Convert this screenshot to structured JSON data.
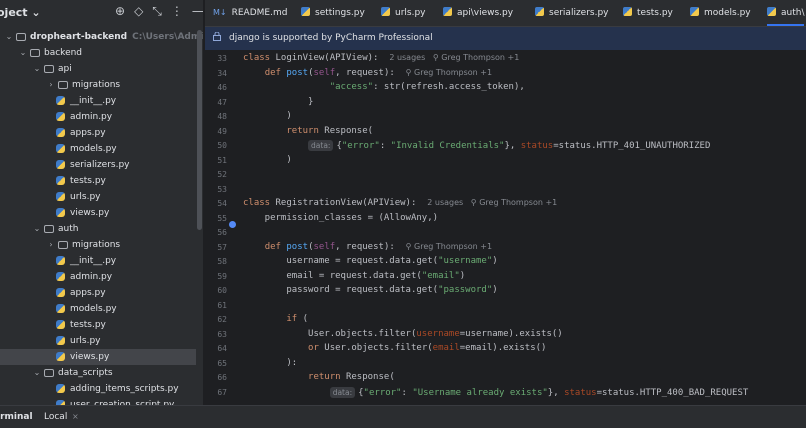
{
  "sidebar": {
    "title": "oject",
    "rows": [
      {
        "chev": "⌄",
        "icon": "folder",
        "label": "dropheart-backend",
        "bold": true,
        "path": "C:\\Users\\Admin\\Documents",
        "indent": 0
      },
      {
        "chev": "⌄",
        "icon": "folder",
        "label": "backend",
        "indent": 1
      },
      {
        "chev": "⌄",
        "icon": "folder",
        "label": "api",
        "indent": 2
      },
      {
        "chev": "›",
        "icon": "folder",
        "label": "migrations",
        "indent": 3
      },
      {
        "icon": "py",
        "label": "__init__.py",
        "indent": 4
      },
      {
        "icon": "py",
        "label": "admin.py",
        "indent": 4
      },
      {
        "icon": "py",
        "label": "apps.py",
        "indent": 4
      },
      {
        "icon": "py",
        "label": "models.py",
        "indent": 4
      },
      {
        "icon": "py",
        "label": "serializers.py",
        "indent": 4
      },
      {
        "icon": "py",
        "label": "tests.py",
        "indent": 4
      },
      {
        "icon": "py",
        "label": "urls.py",
        "indent": 4
      },
      {
        "icon": "py",
        "label": "views.py",
        "indent": 4
      },
      {
        "chev": "⌄",
        "icon": "folder",
        "label": "auth",
        "indent": 2
      },
      {
        "chev": "›",
        "icon": "folder",
        "label": "migrations",
        "indent": 3
      },
      {
        "icon": "py",
        "label": "__init__.py",
        "indent": 4
      },
      {
        "icon": "py",
        "label": "admin.py",
        "indent": 4
      },
      {
        "icon": "py",
        "label": "apps.py",
        "indent": 4
      },
      {
        "icon": "py",
        "label": "models.py",
        "indent": 4
      },
      {
        "icon": "py",
        "label": "tests.py",
        "indent": 4
      },
      {
        "icon": "py",
        "label": "urls.py",
        "indent": 4
      },
      {
        "icon": "py",
        "label": "views.py",
        "indent": 4,
        "selected": true
      },
      {
        "chev": "⌄",
        "icon": "folder",
        "label": "data_scripts",
        "indent": 2
      },
      {
        "icon": "py",
        "label": "adding_items_scripts.py",
        "indent": 4
      },
      {
        "icon": "py",
        "label": "user_creation_script.py",
        "indent": 4
      }
    ]
  },
  "tabs": [
    {
      "label": "README.md",
      "icon": "md",
      "prefix": "M↓"
    },
    {
      "label": "settings.py",
      "icon": "py"
    },
    {
      "label": "urls.py",
      "icon": "py"
    },
    {
      "label": "api\\views.py",
      "icon": "py"
    },
    {
      "label": "serializers.py",
      "icon": "py"
    },
    {
      "label": "tests.py",
      "icon": "py"
    },
    {
      "label": "models.py",
      "icon": "py"
    },
    {
      "label": "auth\\",
      "icon": "py",
      "active": true
    }
  ],
  "banner": {
    "text": "django is supported by PyCharm Professional"
  },
  "code": {
    "lines": [
      {
        "n": "33",
        "html": "<span class='kw'>class</span> LoginView(APIView):  <span class='hint'>2 usages   ⚲ Greg Thompson +1</span>"
      },
      {
        "n": "34",
        "html": "    <span class='kw'>def</span> <span class='fn'>post</span>(<span class='self'>self</span>, request):  <span class='hint'>⚲ Greg Thompson +1</span>"
      },
      {
        "n": "46",
        "html": "                <span class='str'>\"access\"</span>: str(refresh.access_token),"
      },
      {
        "n": "47",
        "html": "            }"
      },
      {
        "n": "48",
        "html": "        )"
      },
      {
        "n": "49",
        "html": "        <span class='kw'>return</span> Response("
      },
      {
        "n": "50",
        "html": "            <span class='badge'>data:</span>{<span class='str'>\"error\"</span>: <span class='str'>\"Invalid Credentials\"</span>}, <span class='kwarg'>status</span>=status.HTTP_401_UNAUTHORIZED"
      },
      {
        "n": "51",
        "html": "        )"
      },
      {
        "n": "52",
        "html": ""
      },
      {
        "n": "53",
        "html": ""
      },
      {
        "n": "54",
        "html": "<span class='kw'>class</span> RegistrationView(APIView):  <span class='hint'>2 usages   ⚲ Greg Thompson +1</span>"
      },
      {
        "n": "55",
        "html": "    permission_classes = (AllowAny,)"
      },
      {
        "n": "56",
        "html": ""
      },
      {
        "n": "57",
        "html": "    <span class='kw'>def</span> <span class='fn'>post</span>(<span class='self'>self</span>, request):  <span class='hint'>⚲ Greg Thompson +1</span>"
      },
      {
        "n": "58",
        "html": "        username = request.data.get(<span class='str'>\"username\"</span>)"
      },
      {
        "n": "59",
        "html": "        email = request.data.get(<span class='str'>\"email\"</span>)"
      },
      {
        "n": "60",
        "html": "        password = request.data.get(<span class='str'>\"password\"</span>)"
      },
      {
        "n": "61",
        "html": ""
      },
      {
        "n": "62",
        "html": "        <span class='kw'>if</span> ("
      },
      {
        "n": "63",
        "html": "            User.objects.filter(<span class='kwarg'>username</span>=username).exists()"
      },
      {
        "n": "64",
        "html": "            <span class='kw'>or</span> User.objects.filter(<span class='kwarg'>email</span>=email).exists()"
      },
      {
        "n": "65",
        "html": "        ):"
      },
      {
        "n": "66",
        "html": "            <span class='kw'>return</span> Response("
      },
      {
        "n": "67",
        "html": "                <span class='badge'>data:</span>{<span class='str'>\"error\"</span>: <span class='str'>\"Username already exists\"</span>}, <span class='kwarg'>status</span>=status.HTTP_400_BAD_REQUEST"
      }
    ]
  },
  "bottom": {
    "tool": "erminal",
    "tab": "Local",
    "close": "×"
  }
}
